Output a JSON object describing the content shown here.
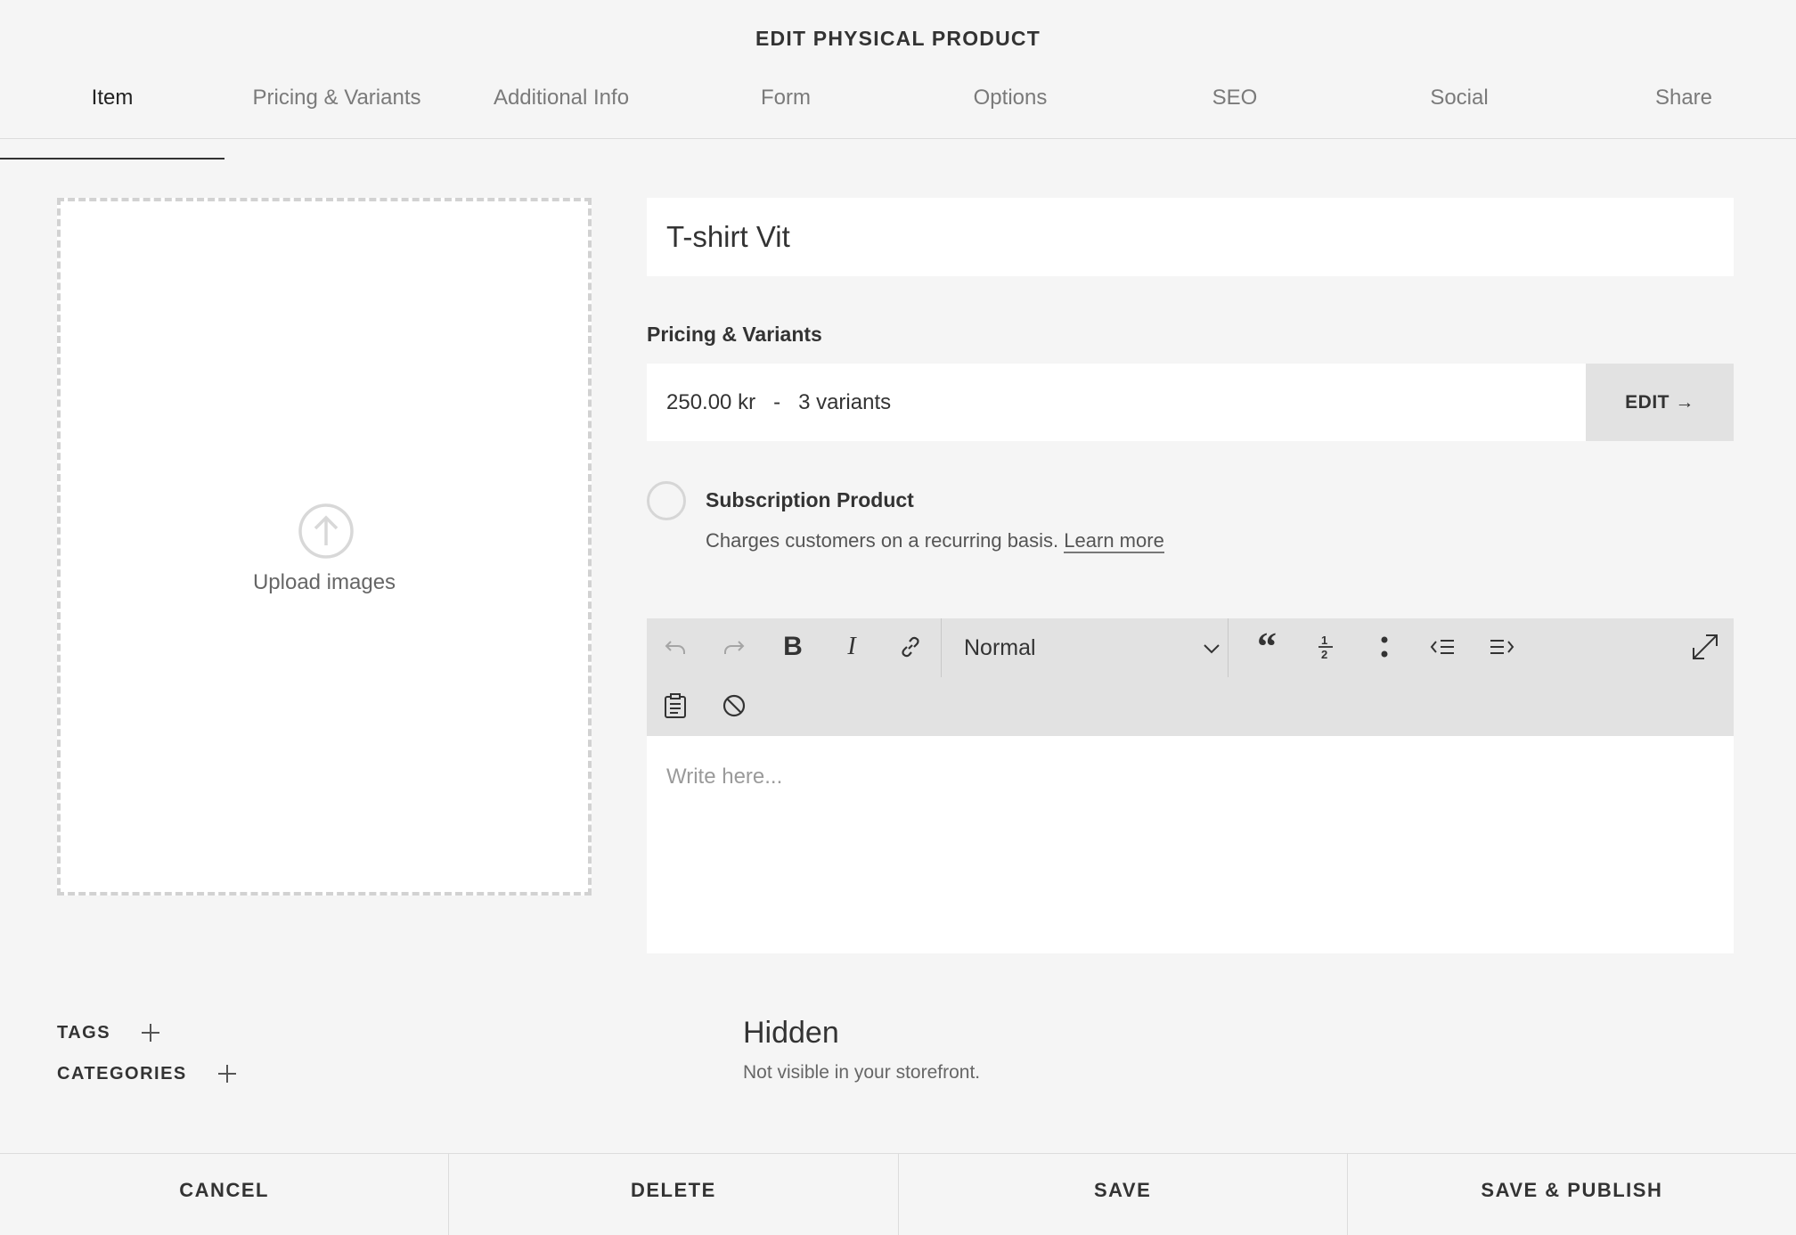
{
  "header": {
    "title": "EDIT PHYSICAL PRODUCT"
  },
  "tabs": [
    {
      "label": "Item",
      "active": true
    },
    {
      "label": "Pricing & Variants"
    },
    {
      "label": "Additional Info"
    },
    {
      "label": "Form"
    },
    {
      "label": "Options"
    },
    {
      "label": "SEO"
    },
    {
      "label": "Social"
    },
    {
      "label": "Share"
    }
  ],
  "upload": {
    "label": "Upload images"
  },
  "product": {
    "title": "T-shirt Vit"
  },
  "pricing": {
    "section_label": "Pricing & Variants",
    "summary": "250.00 kr   -   3 variants",
    "edit_label": "EDIT →"
  },
  "subscription": {
    "title": "Subscription Product",
    "description": "Charges customers on a recurring basis.",
    "learn_more": "Learn more",
    "checked": false
  },
  "editor": {
    "format_value": "Normal",
    "placeholder": "Write here...",
    "toolbar_icons": [
      "undo-icon",
      "redo-icon",
      "bold-icon",
      "italic-icon",
      "link-icon",
      "blockquote-icon",
      "ordered-list-icon",
      "bulleted-list-icon",
      "outdent-icon",
      "indent-icon",
      "expand-icon",
      "paste-plain-icon",
      "clear-format-icon"
    ]
  },
  "meta": {
    "tags_label": "TAGS",
    "categories_label": "CATEGORIES"
  },
  "visibility": {
    "title": "Hidden",
    "description": "Not visible in your storefront."
  },
  "footer": {
    "cancel": "CANCEL",
    "delete": "DELETE",
    "save": "SAVE",
    "save_publish": "SAVE & PUBLISH"
  },
  "colors": {
    "background": "#f5f5f5",
    "toolbar": "#e2e2e2",
    "text": "#333333",
    "muted": "#7a7a7a"
  }
}
